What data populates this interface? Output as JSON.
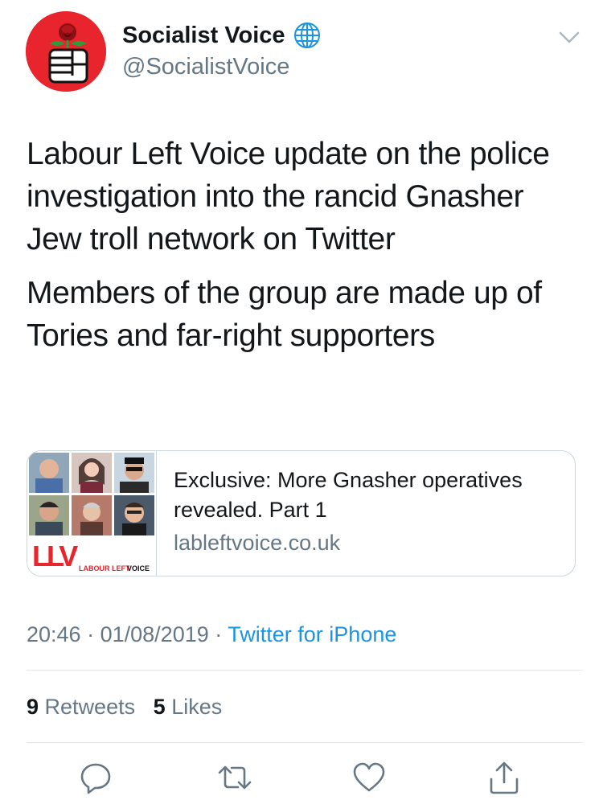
{
  "user": {
    "display_name": "Socialist Voice",
    "handle": "@SocialistVoice",
    "avatar_icon": "rose-fist-logo",
    "verified_icon": "globe-icon"
  },
  "tweet": {
    "paragraphs": [
      "Labour Left Voice update on the police investigation into the rancid Gnasher Jew troll network on Twitter",
      "Members of the group are made up of Tories and far-right supporters"
    ]
  },
  "card": {
    "title": "Exclusive: More Gnasher operatives revealed. Part 1",
    "domain": "lableftvoice.co.uk",
    "logo_text": "LLV",
    "logo_caption": "LABOUR LEFT VOICE"
  },
  "meta": {
    "time": "20:46",
    "date": "01/08/2019",
    "separator": "·",
    "source": "Twitter for iPhone"
  },
  "stats": {
    "retweets_count": "9",
    "retweets_label": "Retweets",
    "likes_count": "5",
    "likes_label": "Likes"
  },
  "colors": {
    "avatar_bg": "#e8242c",
    "link": "#1b95e0",
    "secondary_text": "#657786",
    "border": "#ccd6dd"
  }
}
